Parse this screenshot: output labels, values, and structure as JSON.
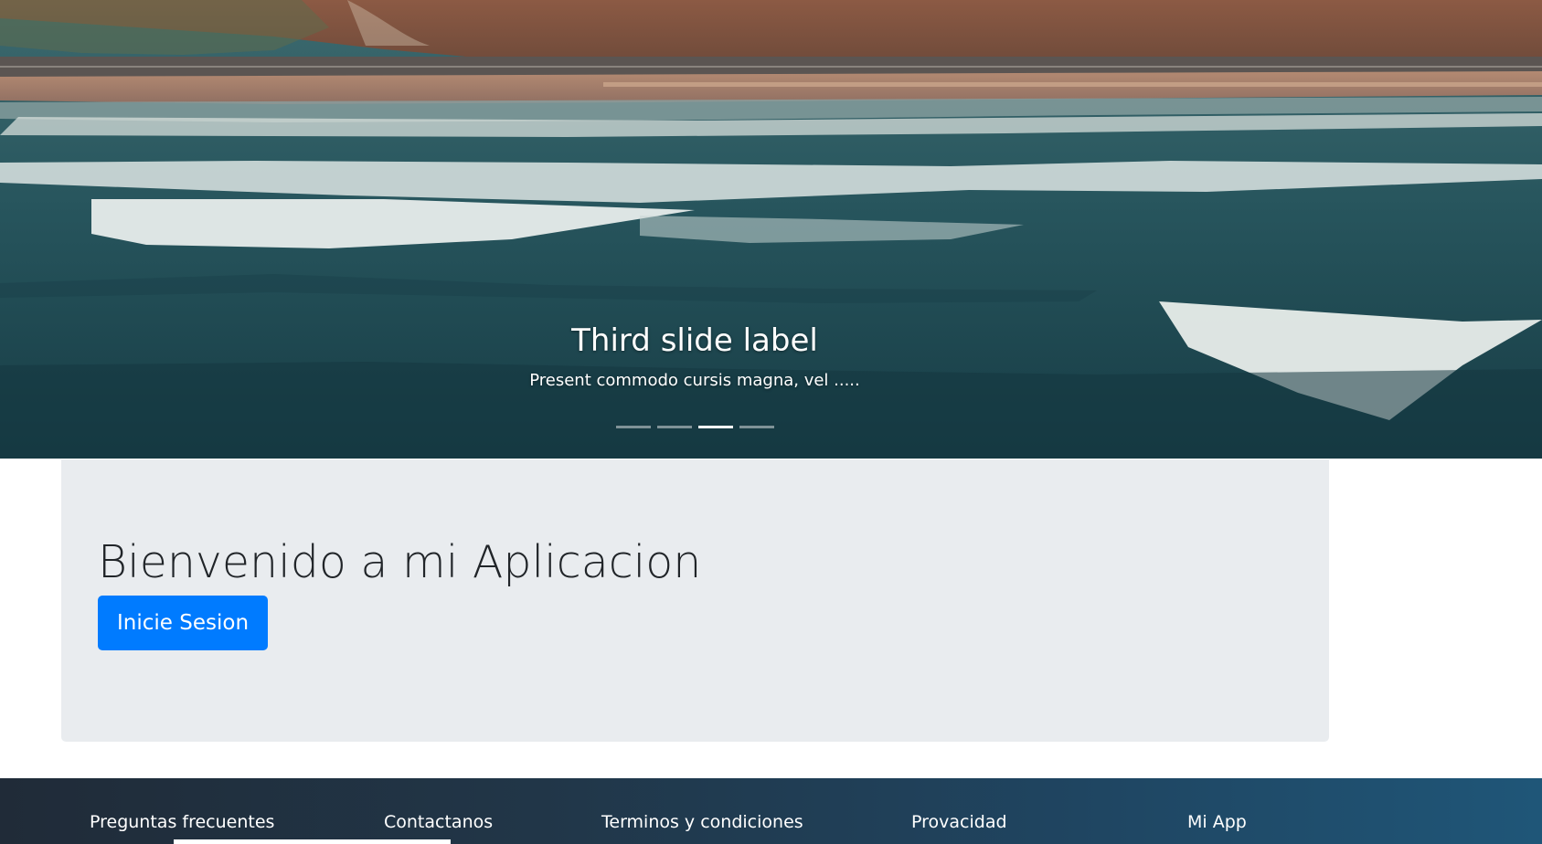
{
  "carousel": {
    "caption_title": "Third slide label",
    "caption_text": "Present commodo cursis magna, vel .....",
    "indicators": {
      "count": 4,
      "active_index": 2
    }
  },
  "jumbotron": {
    "title": "Bienvenido a mi Aplicacion",
    "login_button_label": "Inicie Sesion",
    "button_color": "#007bff",
    "background_color": "#e9ecef"
  },
  "footer": {
    "links": [
      {
        "label": "Preguntas frecuentes"
      },
      {
        "label": "Contactanos"
      },
      {
        "label": "Terminos y condiciones"
      },
      {
        "label": "Provacidad"
      },
      {
        "label": "Mi App"
      }
    ]
  }
}
